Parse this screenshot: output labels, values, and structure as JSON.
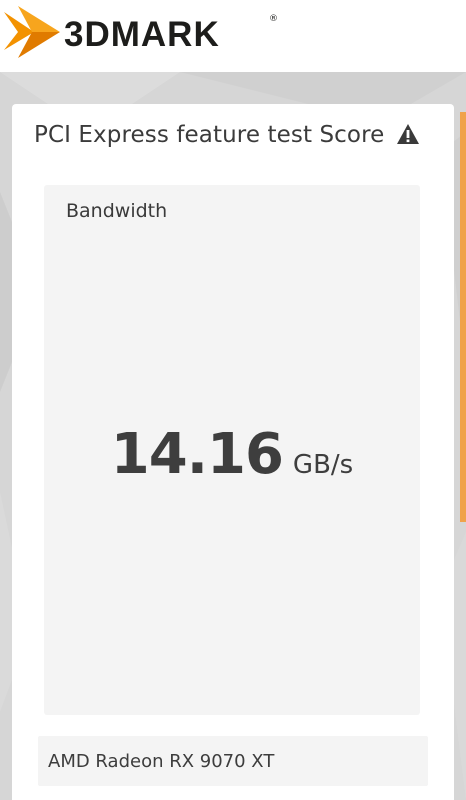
{
  "brand": {
    "name": "3DMARK",
    "registered_mark": "®",
    "accent_color": "#f39200"
  },
  "card": {
    "title": "PCI Express feature test Score",
    "warning_icon": "warning-triangle-icon"
  },
  "result": {
    "label": "Bandwidth",
    "value": "14.16",
    "unit": "GB/s"
  },
  "device": {
    "name": "AMD Radeon RX 9070 XT"
  },
  "colors": {
    "background": "#d6d6d6",
    "card": "#ffffff",
    "panel": "#f4f4f4",
    "text": "#3e3e3e",
    "edge_accent": "#f0a24a"
  }
}
